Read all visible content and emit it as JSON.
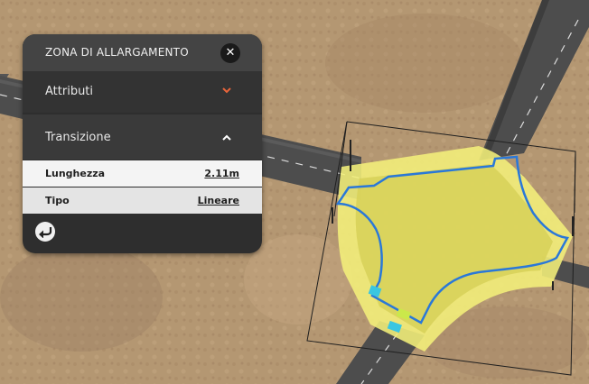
{
  "panel": {
    "title": "ZONA DI ALLARGAMENTO",
    "close_icon": "close-icon",
    "sections": {
      "attributes": {
        "label": "Attributi",
        "icon": "chevron-down-icon",
        "expanded": false
      },
      "transition": {
        "label": "Transizione",
        "icon": "chevron-up-icon",
        "expanded": true
      }
    },
    "properties": {
      "length": {
        "label": "Lunghezza",
        "value": "2.11m"
      },
      "type": {
        "label": "Tipo",
        "value": "Lineare"
      }
    },
    "back_icon": "back-arrow-icon"
  },
  "colors": {
    "panel_bg": "#2e2e2e",
    "header_bg": "#444444",
    "accent_chevron": "#e8643a",
    "road": "#4a4a4a",
    "intersection_fill": "#d8d25a",
    "widening_zone": "#f4f07a",
    "edge_outline": "#2a78d8",
    "terrain": "#b89a76"
  }
}
